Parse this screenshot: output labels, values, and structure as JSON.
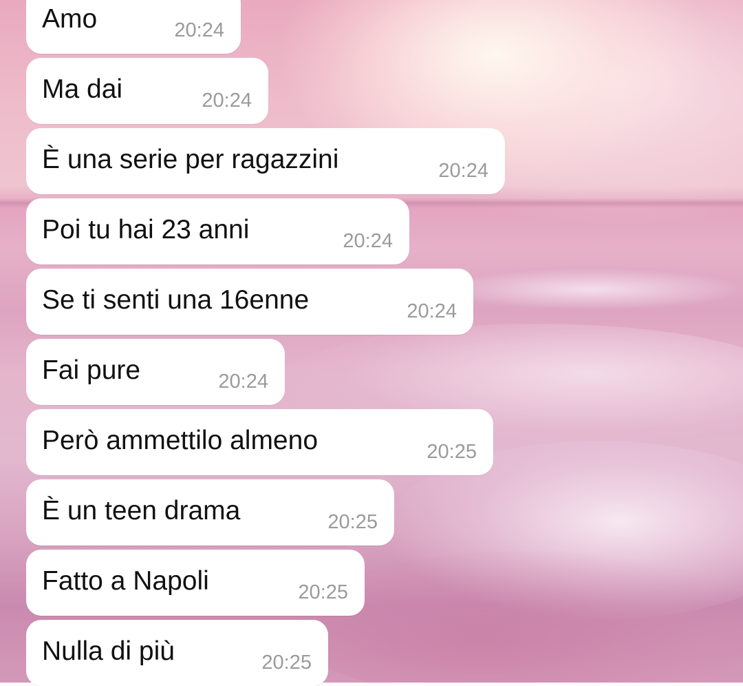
{
  "messages": [
    {
      "text": "Amo",
      "time": "20:24"
    },
    {
      "text": "Ma dai",
      "time": "20:24"
    },
    {
      "text": "È una serie per ragazzini",
      "time": "20:24"
    },
    {
      "text": "Poi tu hai 23 anni",
      "time": "20:24"
    },
    {
      "text": "Se ti senti una 16enne",
      "time": "20:24"
    },
    {
      "text": "Fai pure",
      "time": "20:24"
    },
    {
      "text": "Però ammettilo almeno",
      "time": "20:25"
    },
    {
      "text": "È un teen drama",
      "time": "20:25"
    },
    {
      "text": "Fatto a Napoli",
      "time": "20:25"
    },
    {
      "text": "Nulla di più",
      "time": "20:25"
    }
  ],
  "colors": {
    "bubble": "#ffffff",
    "text": "#111111",
    "timestamp": "#9a9a9a",
    "wallpaper": "#e6b1c8"
  },
  "wallpaper": {
    "icon": "pink-beach-sunset-image"
  }
}
